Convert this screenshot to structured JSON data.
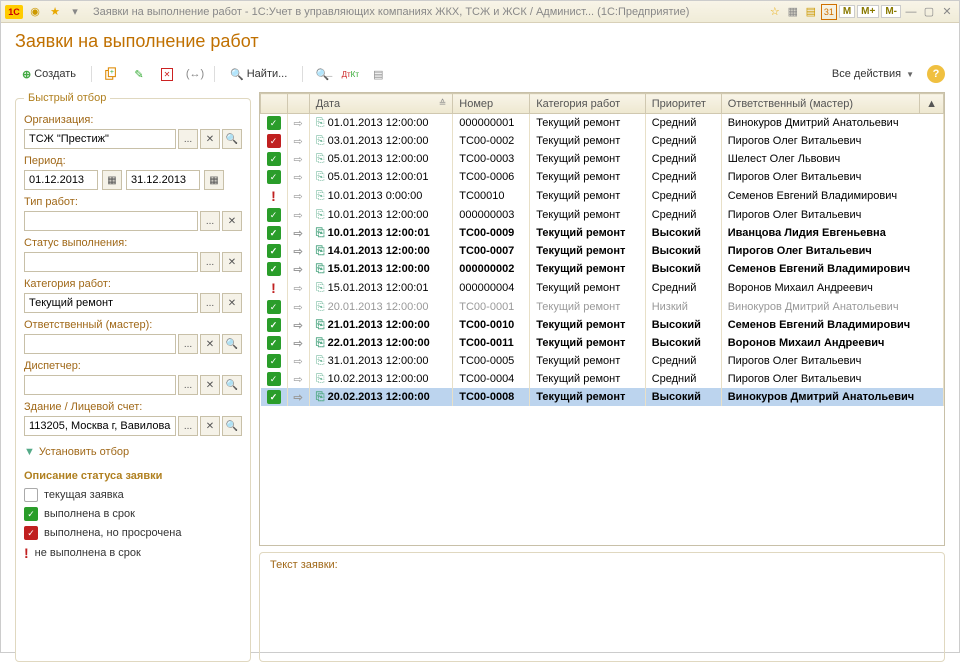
{
  "window_title": "Заявки на выполнение работ - 1С:Учет в управляющих компаниях ЖКХ, ТСЖ и ЖСК / Админист... (1С:Предприятие)",
  "page_title": "Заявки на выполнение работ",
  "toolbar": {
    "create": "Создать",
    "find": "Найти...",
    "all_actions": "Все действия"
  },
  "filter": {
    "legend": "Быстрый отбор",
    "org_label": "Организация:",
    "org_value": "ТСЖ \"Престиж\"",
    "period_label": "Период:",
    "date_from": "01.12.2013",
    "date_to": "31.12.2013",
    "work_type_label": "Тип работ:",
    "work_type_value": "",
    "status_label": "Статус выполнения:",
    "status_value": "",
    "category_label": "Категория работ:",
    "category_value": "Текущий ремонт",
    "responsible_label": "Ответственный (мастер):",
    "responsible_value": "",
    "dispatcher_label": "Диспетчер:",
    "dispatcher_value": "",
    "building_label": "Здание / Лицевой счет:",
    "building_value": "113205, Москва г, Вавилова ул",
    "apply_filter": "Установить отбор",
    "legend_title": "Описание статуса заявки",
    "legend_current": "текущая заявка",
    "legend_done": "выполнена в срок",
    "legend_done_late": "выполнена, но просрочена",
    "legend_overdue": "не выполнена в срок"
  },
  "columns": {
    "date": "Дата",
    "number": "Номер",
    "category": "Категория работ",
    "priority": "Приоритет",
    "responsible": "Ответственный (мастер)"
  },
  "rows": [
    {
      "status": "green",
      "prio": "mid",
      "date": "01.01.2013 12:00:00",
      "num": "000000001",
      "cat": "Текущий ремонт",
      "priority": "Средний",
      "resp": "Винокуров Дмитрий Анатольевич",
      "high": false,
      "sel": false,
      "muted": false
    },
    {
      "status": "red",
      "prio": "mid",
      "date": "03.01.2013 12:00:00",
      "num": "ТС00-0002",
      "cat": "Текущий ремонт",
      "priority": "Средний",
      "resp": "Пирогов Олег Витальевич",
      "high": false,
      "sel": false,
      "muted": false
    },
    {
      "status": "green",
      "prio": "mid",
      "date": "05.01.2013 12:00:00",
      "num": "ТС00-0003",
      "cat": "Текущий ремонт",
      "priority": "Средний",
      "resp": "Шелест Олег Львович",
      "high": false,
      "sel": false,
      "muted": false
    },
    {
      "status": "green",
      "prio": "mid",
      "date": "05.01.2013 12:00:01",
      "num": "ТС00-0006",
      "cat": "Текущий ремонт",
      "priority": "Средний",
      "resp": "Пирогов Олег Витальевич",
      "high": false,
      "sel": false,
      "muted": false
    },
    {
      "status": "excl",
      "prio": "mid",
      "date": "10.01.2013 0:00:00",
      "num": "ТС00010",
      "cat": "Текущий ремонт",
      "priority": "Средний",
      "resp": "Семенов Евгений Владимирович",
      "high": false,
      "sel": false,
      "muted": false
    },
    {
      "status": "green",
      "prio": "mid",
      "date": "10.01.2013 12:00:00",
      "num": "000000003",
      "cat": "Текущий ремонт",
      "priority": "Средний",
      "resp": "Пирогов Олег Витальевич",
      "high": false,
      "sel": false,
      "muted": false
    },
    {
      "status": "green",
      "prio": "mid",
      "date": "10.01.2013 12:00:01",
      "num": "ТС00-0009",
      "cat": "Текущий ремонт",
      "priority": "Высокий",
      "resp": "Иванцова Лидия Евгеньевна",
      "high": true,
      "sel": false,
      "muted": false
    },
    {
      "status": "green",
      "prio": "mid",
      "date": "14.01.2013 12:00:00",
      "num": "ТС00-0007",
      "cat": "Текущий ремонт",
      "priority": "Высокий",
      "resp": "Пирогов Олег Витальевич",
      "high": true,
      "sel": false,
      "muted": false
    },
    {
      "status": "green",
      "prio": "mid",
      "date": "15.01.2013 12:00:00",
      "num": "000000002",
      "cat": "Текущий ремонт",
      "priority": "Высокий",
      "resp": "Семенов Евгений Владимирович",
      "high": true,
      "sel": false,
      "muted": false
    },
    {
      "status": "excl",
      "prio": "mid",
      "date": "15.01.2013 12:00:01",
      "num": "000000004",
      "cat": "Текущий ремонт",
      "priority": "Средний",
      "resp": "Воронов Михаил Андреевич",
      "high": false,
      "sel": false,
      "muted": false
    },
    {
      "status": "green",
      "prio": "mid",
      "date": "20.01.2013 12:00:00",
      "num": "ТС00-0001",
      "cat": "Текущий ремонт",
      "priority": "Низкий",
      "resp": "Винокуров Дмитрий Анатольевич",
      "high": false,
      "sel": false,
      "muted": true
    },
    {
      "status": "green",
      "prio": "mid",
      "date": "21.01.2013 12:00:00",
      "num": "ТС00-0010",
      "cat": "Текущий ремонт",
      "priority": "Высокий",
      "resp": "Семенов Евгений Владимирович",
      "high": true,
      "sel": false,
      "muted": false
    },
    {
      "status": "green",
      "prio": "mid",
      "date": "22.01.2013 12:00:00",
      "num": "ТС00-0011",
      "cat": "Текущий ремонт",
      "priority": "Высокий",
      "resp": "Воронов Михаил Андреевич",
      "high": true,
      "sel": false,
      "muted": false
    },
    {
      "status": "green",
      "prio": "mid",
      "date": "31.01.2013 12:00:00",
      "num": "ТС00-0005",
      "cat": "Текущий ремонт",
      "priority": "Средний",
      "resp": "Пирогов Олег Витальевич",
      "high": false,
      "sel": false,
      "muted": false
    },
    {
      "status": "green",
      "prio": "mid",
      "date": "10.02.2013 12:00:00",
      "num": "ТС00-0004",
      "cat": "Текущий ремонт",
      "priority": "Средний",
      "resp": "Пирогов Олег Витальевич",
      "high": false,
      "sel": false,
      "muted": false
    },
    {
      "status": "green",
      "prio": "mid",
      "date": "20.02.2013 12:00:00",
      "num": "ТС00-0008",
      "cat": "Текущий ремонт",
      "priority": "Высокий",
      "resp": "Винокуров Дмитрий Анатольевич",
      "high": true,
      "sel": true,
      "muted": false
    }
  ],
  "detail": {
    "label": "Текст заявки:"
  },
  "mem_buttons": "M M+ M-"
}
